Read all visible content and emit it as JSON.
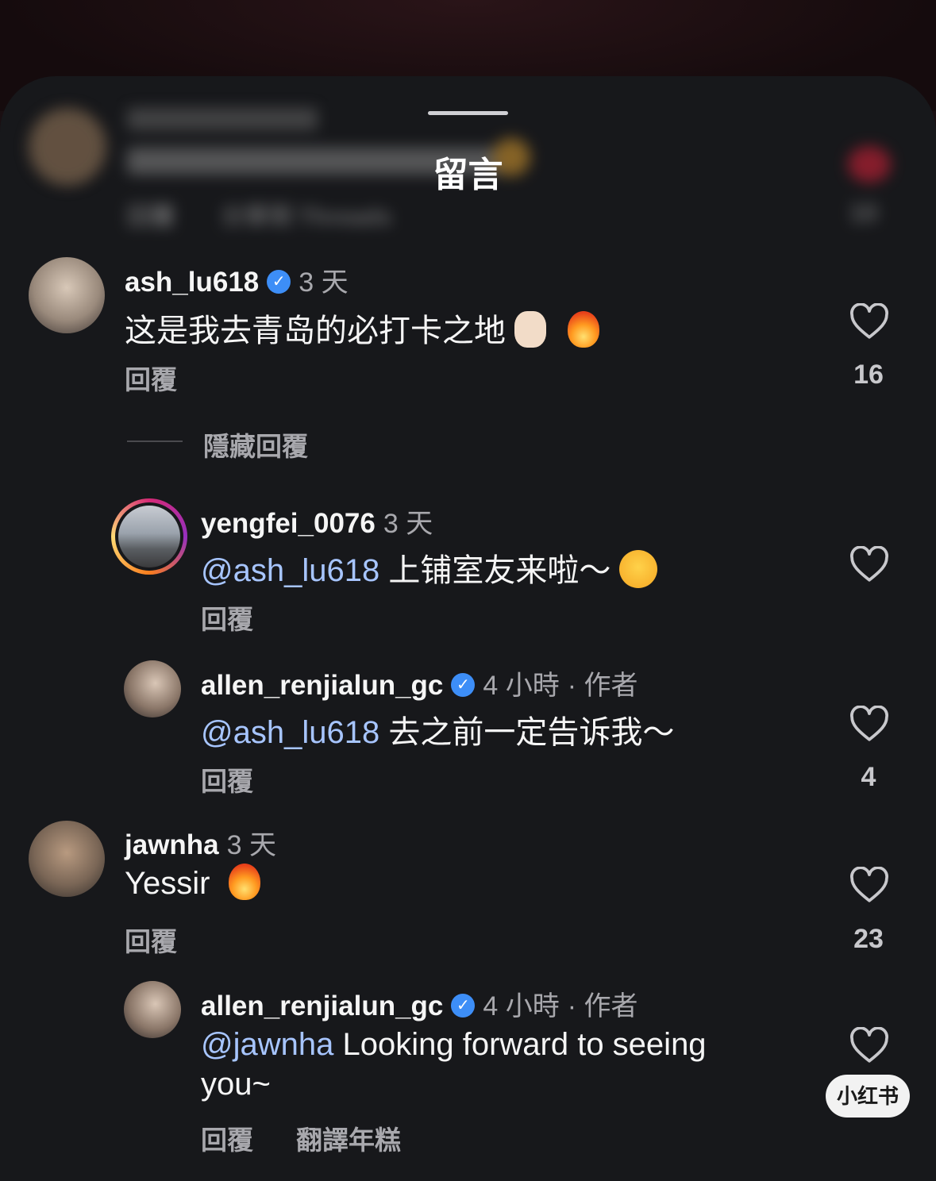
{
  "sheet": {
    "title": "留言"
  },
  "blurred_comment": {
    "reply": "回覆",
    "share": "分享到 Threads",
    "likes": "10"
  },
  "comments": [
    {
      "username": "ash_lu618",
      "time": "3 天",
      "text": "这是我去青岛的必打卡之地",
      "reply": "回覆",
      "likes": "16",
      "hide_replies": "隱藏回覆"
    },
    {
      "username": "yengfei_0076",
      "time": "3 天",
      "mention": "@ash_lu618",
      "text": " 上铺室友来啦～",
      "reply": "回覆"
    },
    {
      "username": "allen_renjialun_gc",
      "time": "4 小時",
      "author_tag": "· 作者",
      "mention": "@ash_lu618",
      "text": " 去之前一定告诉我～",
      "reply": "回覆",
      "likes": "4"
    },
    {
      "username": "jawnha",
      "time": "3 天",
      "text": "Yessir ",
      "reply": "回覆",
      "likes": "23"
    },
    {
      "username": "allen_renjialun_gc",
      "time": "4 小時",
      "author_tag": "· 作者",
      "mention": "@jawnha",
      "text": " Looking forward to seeing",
      "text_line2": "you~",
      "reply": "回覆",
      "translate": "翻譯年糕"
    }
  ],
  "watermark": "小红书",
  "colors": {
    "background": "#17181b",
    "mention": "#a7c5ff",
    "verified": "#3d8ef7",
    "muted": "#a8a8ad"
  },
  "icons": [
    "heart-outline-icon",
    "verified-badge-icon",
    "fire-emoji",
    "rock-on-emoji",
    "heart-eyes-emoji"
  ]
}
